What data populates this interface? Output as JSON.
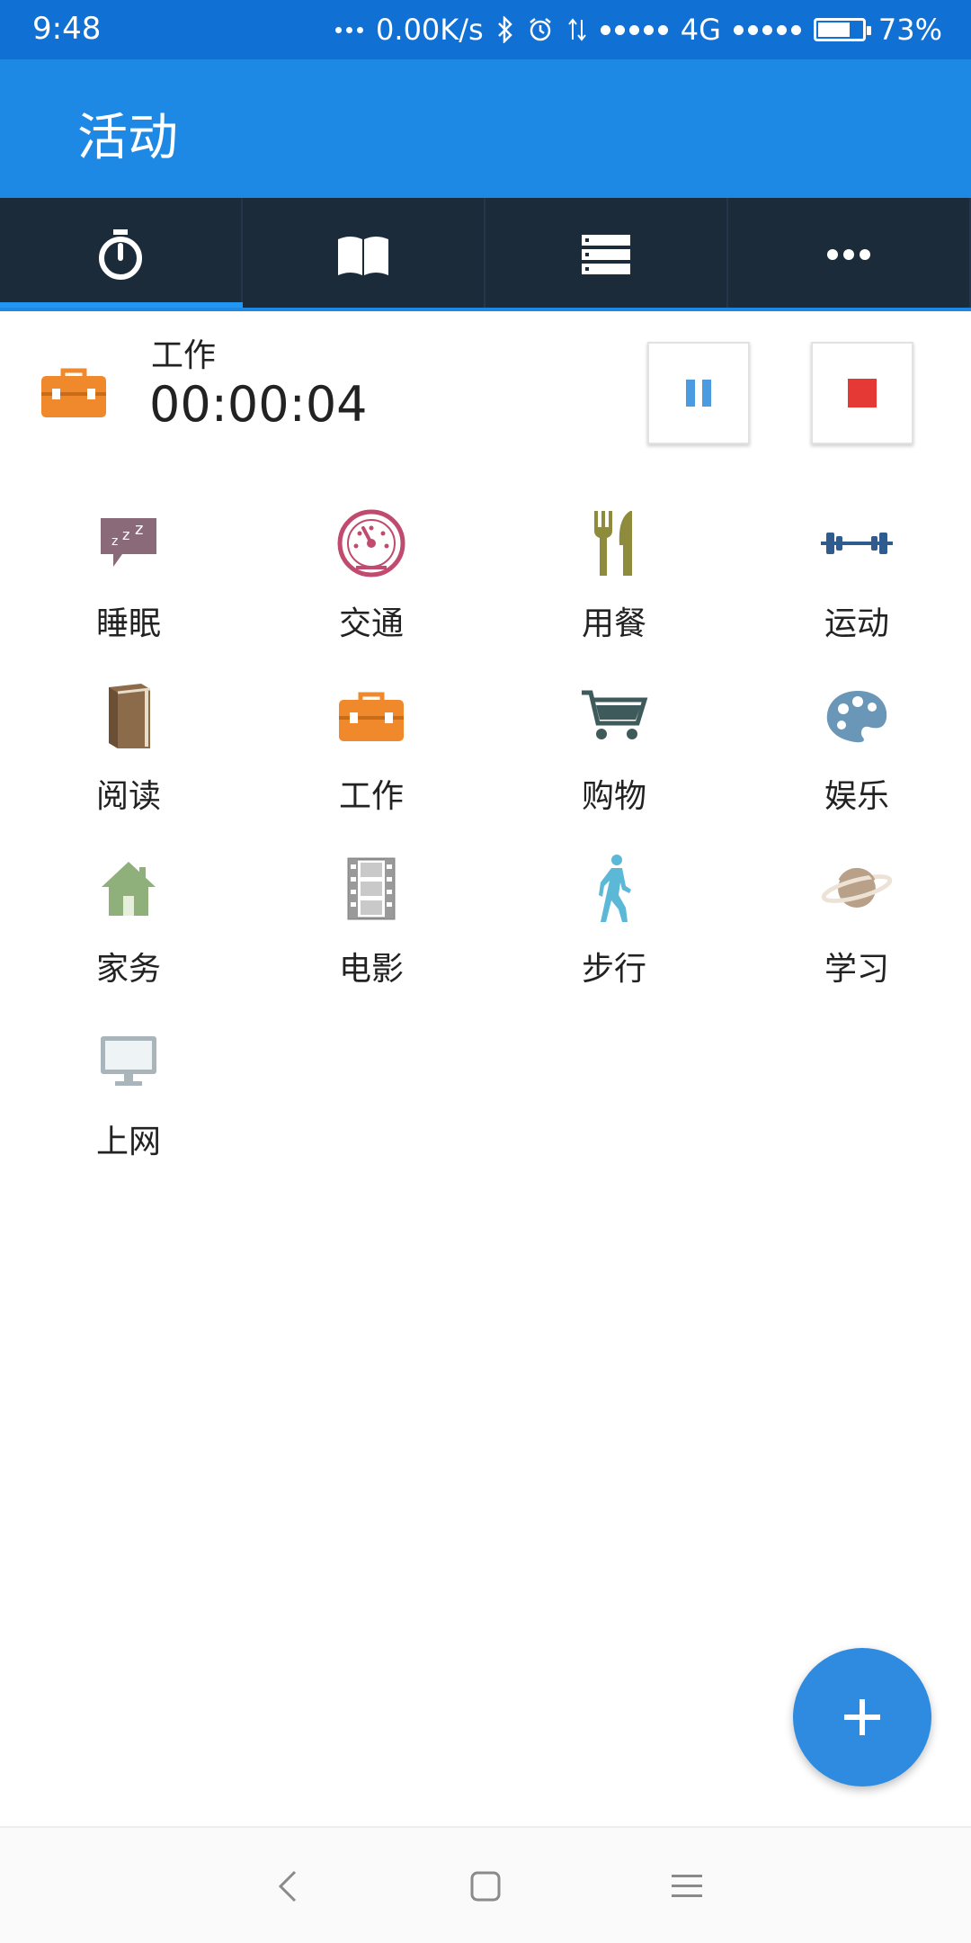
{
  "status_bar": {
    "time": "9:48",
    "net_speed": "0.00K/s",
    "network": "4G",
    "battery_text": "73%",
    "battery_level": 0.73,
    "icons": [
      "more-dots-icon",
      "bluetooth-icon",
      "alarm-icon",
      "data-transfer-icon",
      "signal-icon",
      "signal-2-icon",
      "battery-icon"
    ]
  },
  "app_bar": {
    "title": "活动"
  },
  "tabs": [
    {
      "icon": "stopwatch-icon",
      "active": true
    },
    {
      "icon": "book-icon",
      "active": false
    },
    {
      "icon": "list-icon",
      "active": false
    },
    {
      "icon": "more-icon",
      "active": false
    }
  ],
  "current_activity": {
    "name": "工作",
    "elapsed": "00:00:04",
    "icon": "briefcase-icon",
    "pause_icon": "pause-icon",
    "stop_icon": "stop-icon"
  },
  "activities": [
    {
      "label": "睡眠",
      "icon": "sleep-icon"
    },
    {
      "label": "交通",
      "icon": "speedometer-icon"
    },
    {
      "label": "用餐",
      "icon": "fork-knife-icon"
    },
    {
      "label": "运动",
      "icon": "dumbbell-icon"
    },
    {
      "label": "阅读",
      "icon": "book-icon"
    },
    {
      "label": "工作",
      "icon": "briefcase-icon"
    },
    {
      "label": "购物",
      "icon": "cart-icon"
    },
    {
      "label": "娱乐",
      "icon": "palette-icon"
    },
    {
      "label": "家务",
      "icon": "house-icon"
    },
    {
      "label": "电影",
      "icon": "film-icon"
    },
    {
      "label": "步行",
      "icon": "walking-icon"
    },
    {
      "label": "学习",
      "icon": "planet-icon"
    },
    {
      "label": "上网",
      "icon": "monitor-icon"
    }
  ],
  "fab": {
    "icon": "plus-icon"
  },
  "nav_bar": {
    "icons": [
      "back-icon",
      "home-icon",
      "menu-icon"
    ]
  },
  "colors": {
    "status_bar": "#1170d4",
    "app_bar": "#1e88e5",
    "tab_bar": "#1c2b3a",
    "accent": "#2196f3",
    "briefcase": "#f0892c",
    "stop": "#e53935"
  }
}
